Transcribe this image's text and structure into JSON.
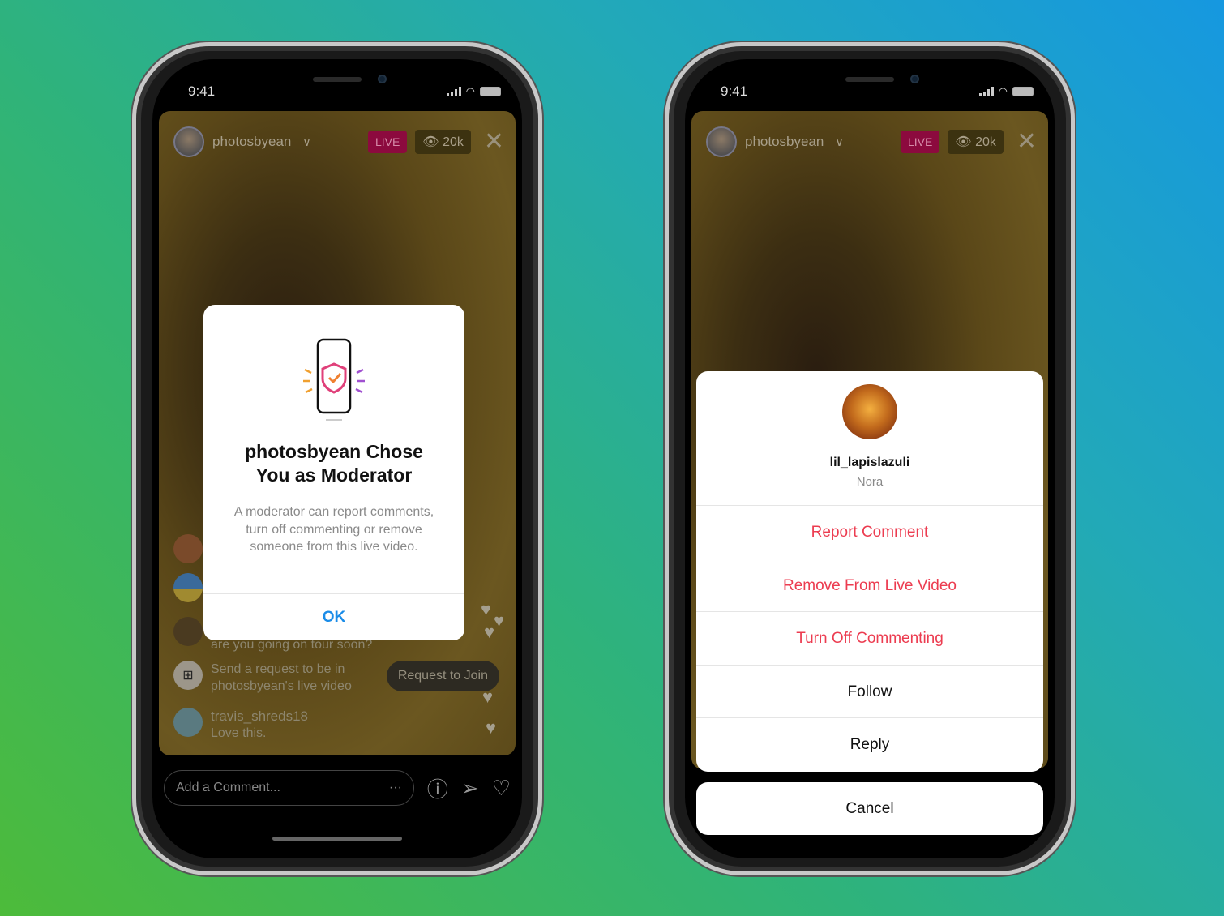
{
  "left_phone": {
    "status": {
      "time": "9:41"
    },
    "header": {
      "username": "photosbyean",
      "live_badge": "LIVE",
      "viewers": "20k"
    },
    "dialog": {
      "title": "photosbyean Chose You as Moderator",
      "body": "A moderator can report comments, turn off commenting or remove someone from this live video.",
      "ok_label": "OK"
    },
    "comments": [
      {
        "text": "are you going on tour soon?"
      },
      {
        "text": "Send a request to be in photosbyean's live video"
      },
      {
        "username": "travis_shreds18",
        "text": "Love this."
      }
    ],
    "request_join_label": "Request to Join",
    "comment_placeholder": "Add a Comment...",
    "more_label": "···"
  },
  "right_phone": {
    "status": {
      "time": "9:41"
    },
    "header": {
      "username": "photosbyean",
      "live_badge": "LIVE",
      "viewers": "20k"
    },
    "sheet": {
      "username": "lil_lapislazuli",
      "full_name": "Nora",
      "options": [
        "Report Comment",
        "Remove From Live Video",
        "Turn Off Commenting",
        "Follow",
        "Reply"
      ],
      "cancel_label": "Cancel"
    }
  },
  "colors": {
    "accent_blue": "#1a8ce8",
    "destructive_red": "#ec3c50",
    "live_badge": "#8c0a3e"
  }
}
